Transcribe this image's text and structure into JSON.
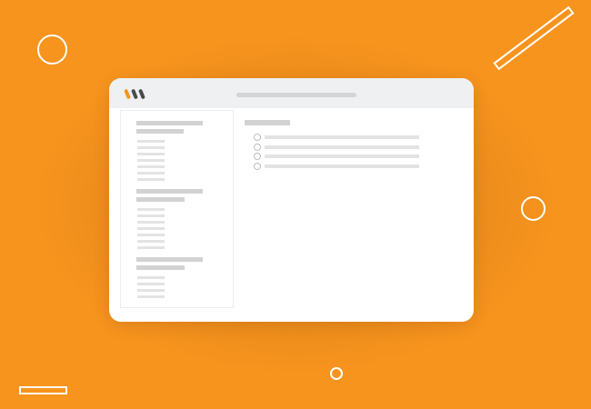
{
  "colors": {
    "background": "#F7941E",
    "window": "#FFFFFF",
    "titlebar": "#EFF0F2",
    "placeholder": "#DCDCDC",
    "logo_accent": "#F7941E",
    "logo_dark": "#4A4A4A"
  },
  "window": {
    "logo_icon": "app-logo-icon",
    "sidebar": {
      "sections": [
        {
          "heading_lines": 2,
          "item_lines": 7
        },
        {
          "heading_lines": 2,
          "item_lines": 7
        },
        {
          "heading_lines": 2,
          "item_lines": 4
        }
      ]
    },
    "main": {
      "title_lines": 1,
      "options": [
        {
          "selected": false
        },
        {
          "selected": false
        },
        {
          "selected": false
        },
        {
          "selected": false
        }
      ]
    }
  }
}
